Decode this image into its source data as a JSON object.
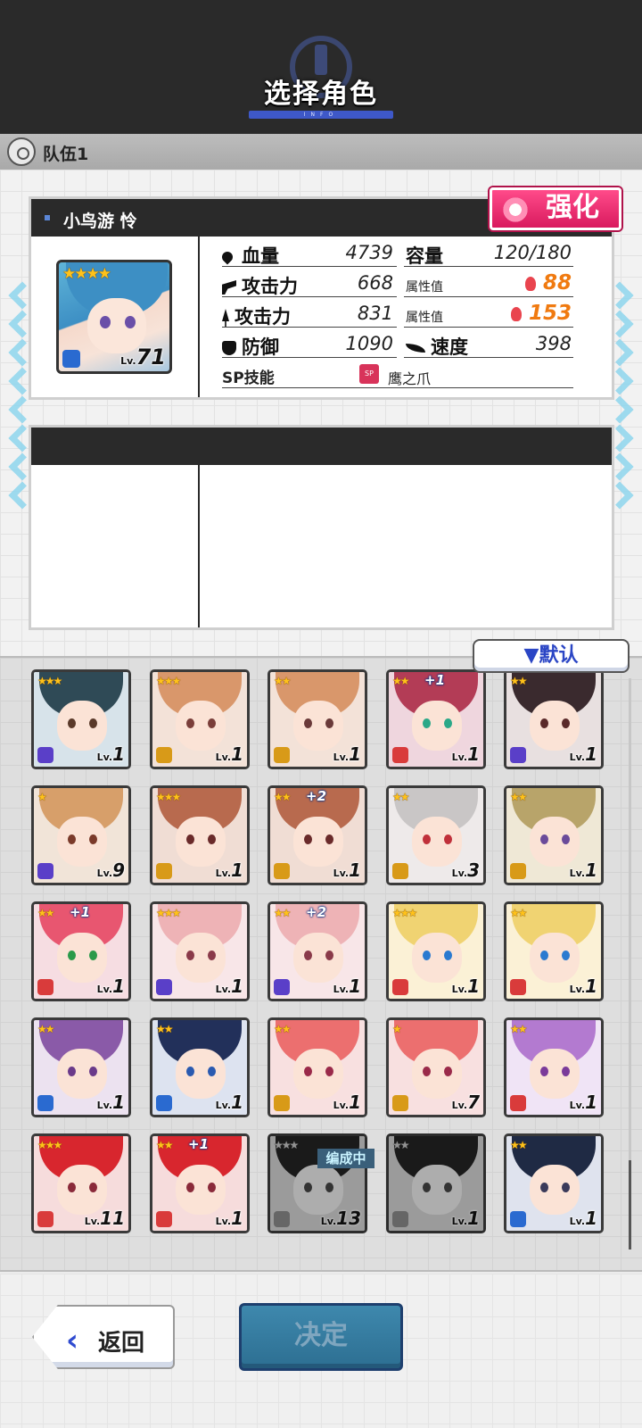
{
  "header": {
    "title": "选择角色",
    "subtitle": "INFO"
  },
  "team": {
    "label": "队伍1"
  },
  "character": {
    "name": "小鸟游 怜",
    "stars": "★★★★",
    "level": "71",
    "level_prefix": "Lv.",
    "enhance_label": "强化",
    "stats": {
      "hp_label": "血量",
      "hp_value": "4739",
      "capacity_label": "容量",
      "capacity_value": "120/180",
      "atk_label": "攻击力",
      "atk_value": "668",
      "atk_attr_label": "属性值",
      "atk_attr_value": "88",
      "atk2_label": "攻击力",
      "atk2_value": "831",
      "atk2_attr_label": "属性值",
      "atk2_attr_value": "153",
      "def_label": "防御",
      "def_value": "1090",
      "spd_label": "速度",
      "spd_value": "398",
      "sp_label": "SP技能",
      "sp_badge": "SP",
      "sp_value": "鹰之爪"
    }
  },
  "sort": {
    "label": "▼默认"
  },
  "in_team_label": "编成中",
  "roster": [
    {
      "stars": "★★★",
      "plus": "",
      "level": "1",
      "hair": "#2f4a56",
      "eye": "#5a3a2a",
      "bg": "#d7e3ea",
      "weapon": "#5a3fc8",
      "gray": false
    },
    {
      "stars": "★★★",
      "plus": "",
      "level": "1",
      "hair": "#d9976b",
      "eye": "#7a3e3a",
      "bg": "#f3e2d8",
      "weapon": "#d89a18",
      "gray": false
    },
    {
      "stars": "★★",
      "plus": "",
      "level": "1",
      "hair": "#d9976b",
      "eye": "#6a3a3a",
      "bg": "#f3e2d8",
      "weapon": "#d89a18",
      "gray": false
    },
    {
      "stars": "★★",
      "plus": "+1",
      "level": "1",
      "hair": "#b33c56",
      "eye": "#2aa888",
      "bg": "#efd6de",
      "weapon": "#d93b3b",
      "gray": false
    },
    {
      "stars": "★★",
      "plus": "",
      "level": "1",
      "hair": "#3a2a2e",
      "eye": "#5a2a2a",
      "bg": "#e8e0e0",
      "weapon": "#5a3fc8",
      "gray": false
    },
    {
      "stars": "★",
      "plus": "",
      "level": "9",
      "hair": "#d79f6a",
      "eye": "#7a3a2a",
      "bg": "#f1e4d8",
      "weapon": "#5a3fc8",
      "gray": false
    },
    {
      "stars": "★★★",
      "plus": "",
      "level": "1",
      "hair": "#b86a4e",
      "eye": "#6a2a2a",
      "bg": "#f0ddd4",
      "weapon": "#d89a18",
      "gray": false
    },
    {
      "stars": "★★",
      "plus": "+2",
      "level": "1",
      "hair": "#b86a4e",
      "eye": "#6a2a2a",
      "bg": "#f0ddd4",
      "weapon": "#d89a18",
      "gray": false
    },
    {
      "stars": "★★",
      "plus": "",
      "level": "3",
      "hair": "#c9c6c6",
      "eye": "#c0303a",
      "bg": "#eeeaea",
      "weapon": "#d89a18",
      "gray": false
    },
    {
      "stars": "★★",
      "plus": "",
      "level": "1",
      "hair": "#b8a46a",
      "eye": "#6a4a9a",
      "bg": "#efe8d6",
      "weapon": "#d89a18",
      "gray": false
    },
    {
      "stars": "★★",
      "plus": "+1",
      "level": "1",
      "hair": "#e85670",
      "eye": "#2a9a4a",
      "bg": "#f6dde2",
      "weapon": "#d93b3b",
      "gray": false
    },
    {
      "stars": "★★★",
      "plus": "",
      "level": "1",
      "hair": "#eeb3b6",
      "eye": "#8a3a4a",
      "bg": "#f8e6e8",
      "weapon": "#5a3fc8",
      "gray": false
    },
    {
      "stars": "★★",
      "plus": "+2",
      "level": "1",
      "hair": "#eeb3b6",
      "eye": "#8a3a4a",
      "bg": "#f8e6e8",
      "weapon": "#5a3fc8",
      "gray": false
    },
    {
      "stars": "★★★",
      "plus": "",
      "level": "1",
      "hair": "#f0d372",
      "eye": "#2a7ad0",
      "bg": "#fbf1d6",
      "weapon": "#d93b3b",
      "gray": false
    },
    {
      "stars": "★★",
      "plus": "",
      "level": "1",
      "hair": "#f0d372",
      "eye": "#2a7ad0",
      "bg": "#fbf1d6",
      "weapon": "#d93b3b",
      "gray": false
    },
    {
      "stars": "★★",
      "plus": "",
      "level": "1",
      "hair": "#8a5aa8",
      "eye": "#6a3a8a",
      "bg": "#ece2f0",
      "weapon": "#2a6ad0",
      "gray": false
    },
    {
      "stars": "★★",
      "plus": "",
      "level": "1",
      "hair": "#22305a",
      "eye": "#2a5ab0",
      "bg": "#dde3f0",
      "weapon": "#2a6ad0",
      "gray": false
    },
    {
      "stars": "★★",
      "plus": "",
      "level": "1",
      "hair": "#ec6f6f",
      "eye": "#9a2a4a",
      "bg": "#f8e0e0",
      "weapon": "#d89a18",
      "gray": false
    },
    {
      "stars": "★",
      "plus": "",
      "level": "7",
      "hair": "#ec6f6f",
      "eye": "#9a2a4a",
      "bg": "#f8e0e0",
      "weapon": "#d89a18",
      "gray": false
    },
    {
      "stars": "★★",
      "plus": "",
      "level": "1",
      "hair": "#b37ad0",
      "eye": "#7a3a9a",
      "bg": "#f0e4f6",
      "weapon": "#d93b3b",
      "gray": false
    },
    {
      "stars": "★★★",
      "plus": "",
      "level": "11",
      "hair": "#d8262e",
      "eye": "#8a2a3a",
      "bg": "#f6dcdc",
      "weapon": "#d93b3b",
      "gray": false
    },
    {
      "stars": "★★",
      "plus": "+1",
      "level": "1",
      "hair": "#d8262e",
      "eye": "#8a2a3a",
      "bg": "#f6dcdc",
      "weapon": "#d93b3b",
      "gray": false
    },
    {
      "stars": "★★★",
      "plus": "",
      "level": "13",
      "hair": "#222",
      "eye": "#444",
      "bg": "#cfcfcf",
      "weapon": "#888",
      "gray": true
    },
    {
      "stars": "★★",
      "plus": "",
      "level": "1",
      "hair": "#222",
      "eye": "#444",
      "bg": "#cfcfcf",
      "weapon": "#888",
      "gray": true
    },
    {
      "stars": "★★",
      "plus": "",
      "level": "1",
      "hair": "#1f2a44",
      "eye": "#3a3a5a",
      "bg": "#dfe3ee",
      "weapon": "#2a6ad0",
      "gray": false
    }
  ],
  "footer": {
    "back_label": "返回",
    "back_arrow": "‹",
    "confirm_label": "决定"
  }
}
